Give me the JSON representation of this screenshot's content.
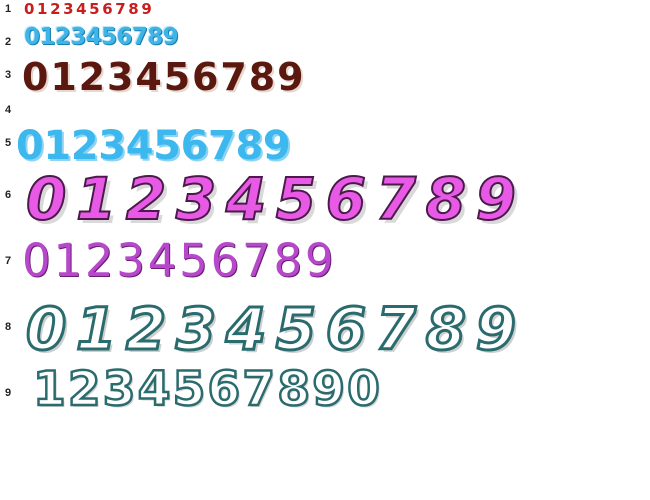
{
  "rows": [
    {
      "number": "1",
      "digits": "0123456789"
    },
    {
      "number": "2",
      "digits": "0123456789"
    },
    {
      "number": "3",
      "digits": "0123456789"
    },
    {
      "number": "4",
      "digits": ""
    },
    {
      "number": "5",
      "digits": "0123456789"
    },
    {
      "number": "6",
      "digits": "0123456789"
    },
    {
      "number": "7",
      "digits": "0123456789"
    },
    {
      "number": "8",
      "digits": "0123456789"
    },
    {
      "number": "9",
      "digits": "1234567890"
    }
  ],
  "colors": {
    "row1": "#c81e1e",
    "row2": "#3fb4e6",
    "row3": "#5a180e",
    "row5": "#3cb8ee",
    "row6": "#e85ae6",
    "row7": "#b748cc",
    "row8_outline": "#2a6b6e",
    "row9_outline": "#2a6b6e"
  }
}
